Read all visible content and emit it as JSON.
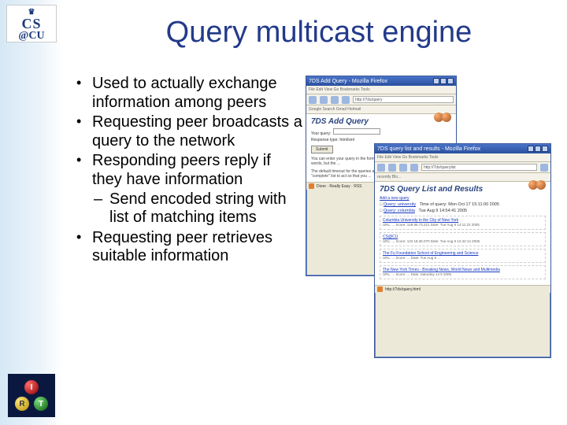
{
  "logo_top": {
    "line1": "CS",
    "line2": "@CU"
  },
  "logo_bottom": {
    "i": "I",
    "r": "R",
    "t": "T"
  },
  "title": "Query multicast engine",
  "bullets": [
    "Used to actually exchange information among peers",
    "Requesting peer broadcasts a query to the network",
    "Responding peers reply if they have information",
    "Requesting peer retrieves suitable information"
  ],
  "sub_bullet": "Send encoded string with list of matching items",
  "screenshot1": {
    "window_title": "7DS Add Query - Mozilla Firefox",
    "menu": "File  Edit  View  Go  Bookmarks  Tools",
    "addr": "http://7ds/query",
    "bookmark_bar": "Google Search   Gmail   Hotmail",
    "page_title": "7DS Add Query",
    "label_query": "Your query:",
    "label_response": "Response type:",
    "response_value": "html/xml",
    "submit": "Submit",
    "help1": "You can enter your query in the form above. It can be a single word or series of words, but the ...",
    "help2": "The default timeout for the queries are \"best-effort\", that is you would like the \"complete\" list to act so that you ...",
    "status": "Done · Really Easy · RSS"
  },
  "screenshot2": {
    "window_title": "7DS query list and results - Mozilla Firefox",
    "menu": "File  Edit  View  Go  Bookmarks  Tools",
    "addr": "http://7ds/querylist",
    "bookmark_bar": "recently Blo...",
    "page_title": "7DS Query List and Results",
    "add_link": "Add a new query",
    "q1_label": "Query: university",
    "q1_time": "Time of query: Mon Oct 17 15:11:00 2005",
    "q2_label": "Query: columbia",
    "q2_time": "Tue Aug 9 14:54:41 2005",
    "results": [
      {
        "link": "Columbia University in the City of New York",
        "meta": "URL: ...  Score: 129.95.73.221  Date: Tue Aug 9 14:11:23 2005"
      },
      {
        "link": "CS@CU",
        "meta": "URL: ...  Score: 122.18.36.070  Date: Tue Aug 9 12:42:14 2005"
      },
      {
        "link": "The Fu Foundation School of Engineering and Science",
        "meta": "URL: ...  Score: ...  Date: Tue Aug 9 ..."
      },
      {
        "link": "The New York Times - Breaking News, World News and Multimedia",
        "meta": "URL: ...  Score: ...  Date: Saturday 14 5 2005"
      }
    ],
    "status": "http://7ds/query.html"
  }
}
